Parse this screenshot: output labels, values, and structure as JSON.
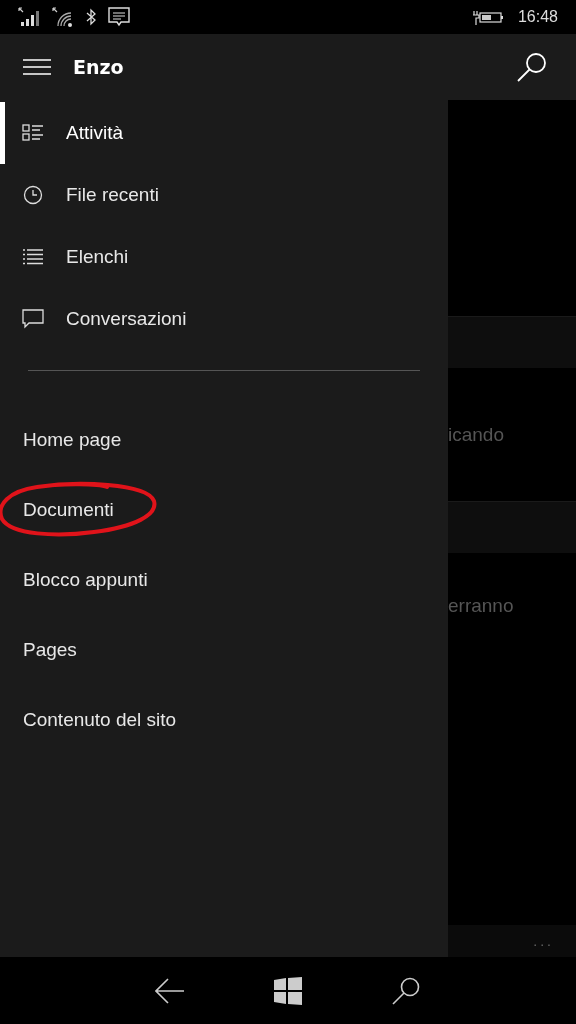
{
  "status_bar": {
    "time": "16:48"
  },
  "drawer": {
    "title": "Enzo",
    "items": [
      {
        "label": "Attività",
        "selected": true
      },
      {
        "label": "File recenti",
        "selected": false
      },
      {
        "label": "Elenchi",
        "selected": false
      },
      {
        "label": "Conversazioni",
        "selected": false
      }
    ],
    "links": [
      {
        "label": "Home page",
        "circled": false
      },
      {
        "label": "Documenti",
        "circled": true
      },
      {
        "label": "Blocco appunti",
        "circled": false
      },
      {
        "label": "Pages",
        "circled": false
      },
      {
        "label": "Contenuto del sito",
        "circled": false
      }
    ]
  },
  "background": {
    "texts": [
      "icando",
      "erranno"
    ],
    "more": "..."
  }
}
